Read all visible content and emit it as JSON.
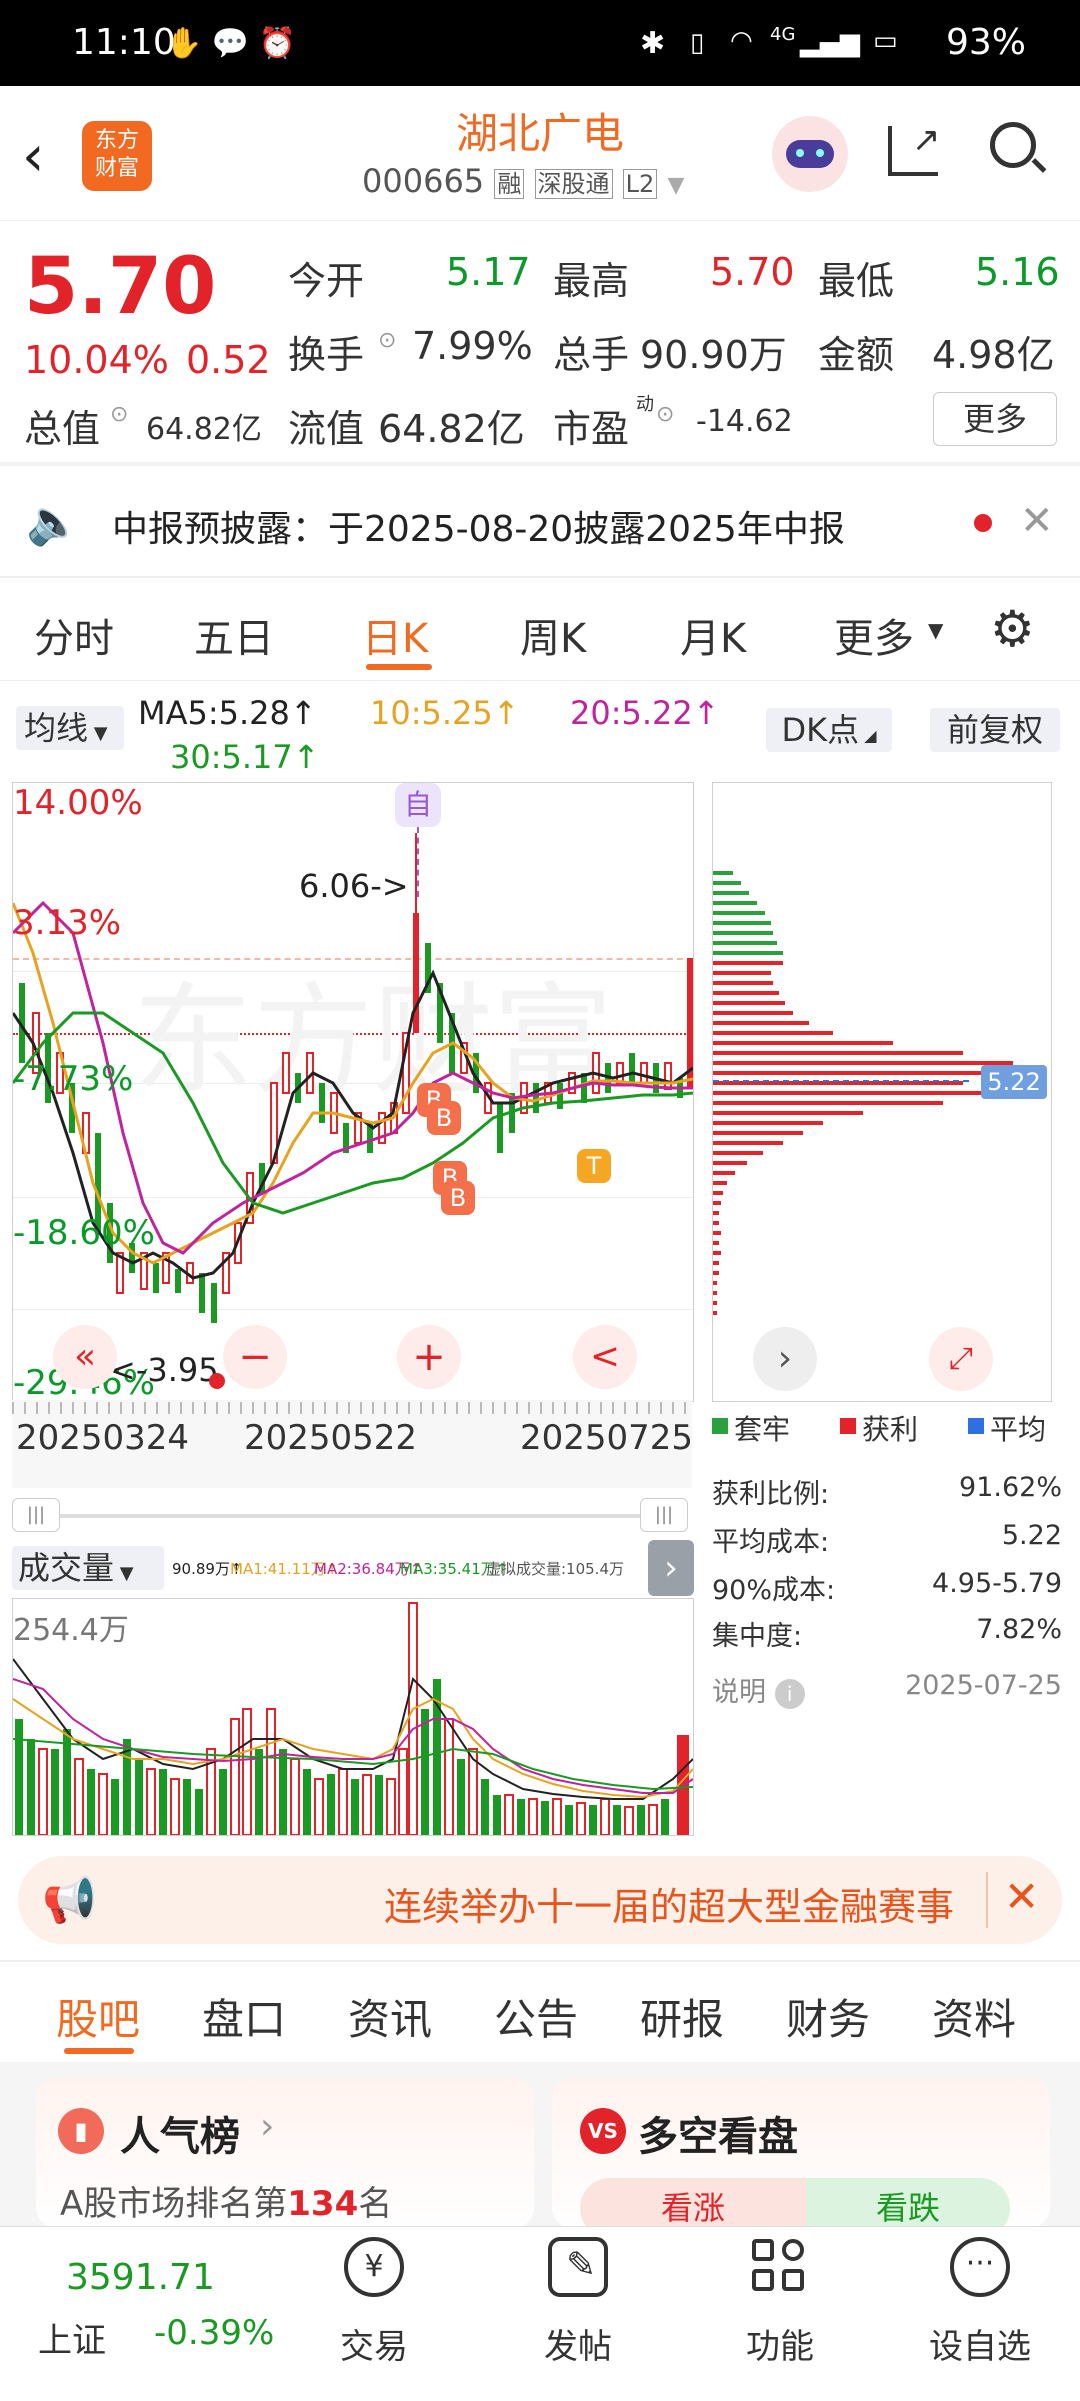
{
  "status_bar": {
    "time": "11:10",
    "network": "4G",
    "battery": "93%"
  },
  "header": {
    "app_logo": "东方\n财富",
    "title": "湖北广电",
    "code": "000665",
    "badge_rong": "融",
    "badge_shengu": "深股通",
    "badge_level": "L2"
  },
  "quote": {
    "price": "5.70",
    "change_pct": "10.04%",
    "change": "0.52",
    "open_label": "今开",
    "open": "5.17",
    "high_label": "最高",
    "high": "5.70",
    "low_label": "最低",
    "low": "5.16",
    "turnover_label": "换手",
    "turnover": "7.99%",
    "volume_label": "总手",
    "volume": "90.90万",
    "amount_label": "金额",
    "amount": "4.98亿",
    "mktcap_label": "总值",
    "mktcap": "64.82亿",
    "float_label": "流值",
    "float": "64.82亿",
    "pe_label": "市盈",
    "pe_sup": "动",
    "pe": "-14.62",
    "more_label": "更多"
  },
  "notice": {
    "text": "中报预披露：于2025-08-20披露2025年中报"
  },
  "chart_tabs": [
    "分时",
    "五日",
    "日K",
    "周K",
    "月K",
    "更多"
  ],
  "active_tab": "日K",
  "ma_bar": {
    "ma_select": "均线",
    "ma5": "MA5:5.28↑",
    "ma10": "10:5.25↑",
    "ma20": "20:5.22↑",
    "ma30": "30:5.17↑",
    "dk_label": "DK点",
    "fq_label": "前复权"
  },
  "kline": {
    "pct_labels": [
      "14.00%",
      "3.13%",
      "-7.73%",
      "-18.60%",
      "-29.46%"
    ],
    "high_marker": "6.06->",
    "low_marker": "<-3.95",
    "self_marker": "自",
    "b_markers": [
      "B",
      "B",
      "B",
      "B"
    ],
    "t_marker": "T",
    "dates": [
      "20250324",
      "20250522",
      "20250725"
    ],
    "zoom_out": "−",
    "zoom_in": "+",
    "prev": "<",
    "fast_back": "«"
  },
  "chip": {
    "avg_tag": "5.22",
    "legend": [
      "套牢",
      "获利",
      "平均"
    ],
    "legend_colors": [
      "#2aa13c",
      "#e2232a",
      "#2f6fe0"
    ],
    "rows": [
      {
        "label": "获利比例:",
        "value": "91.62%"
      },
      {
        "label": "平均成本:",
        "value": "5.22"
      },
      {
        "label": "90%成本:",
        "value": "4.95-5.79"
      },
      {
        "label": "集中度:",
        "value": "7.82%"
      }
    ],
    "note_label": "说明",
    "date": "2025-07-25"
  },
  "volume": {
    "select": "成交量",
    "vol": "90.89万↑",
    "ma1": "MA1:41.11万↑",
    "ma2": "MA2:36.84万↑",
    "ma3": "MA3:35.41万↑",
    "virtual": "虚拟成交量:105.4万",
    "max_label": "254.4万"
  },
  "ad": {
    "text": "连续举办十一届的超大型金融赛事"
  },
  "content_tabs": [
    "股吧",
    "盘口",
    "资讯",
    "公告",
    "研报",
    "财务",
    "资料"
  ],
  "active_content_tab": "股吧",
  "cards": {
    "popular_title": "人气榜",
    "popular_rank_prefix": "A股市场排名第",
    "popular_rank": "134",
    "popular_rank_suffix": "名",
    "duokong_title": "多空看盘",
    "bull": "看涨",
    "bear": "看跌"
  },
  "bottom_bar": {
    "index_value": "3591.71",
    "index_name": "上证",
    "index_change": "-0.39%",
    "tabs": [
      "交易",
      "发帖",
      "功能",
      "设自选"
    ]
  }
}
